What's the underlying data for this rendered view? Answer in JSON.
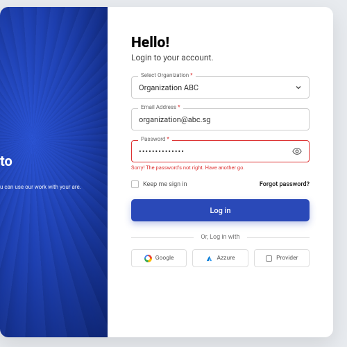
{
  "left": {
    "welcome_line": "to",
    "description": "u can use our work with your are."
  },
  "form": {
    "title": "Hello!",
    "subtitle": "Login to your account.",
    "org": {
      "label": "Select Organization",
      "value": "Organization ABC"
    },
    "email": {
      "label": "Email Address",
      "value": "organization@abc.sg"
    },
    "password": {
      "label": "Password",
      "value": "••••••••••••••",
      "error": "Sorry! The password's not right. Have another go."
    },
    "keep_label": "Keep me sign in",
    "forgot_label": "Forgot password?",
    "login_label": "Log in",
    "or_label": "Or, Log in with",
    "social": {
      "google": "Google",
      "azure": "Azzure",
      "provider": "Provider"
    }
  }
}
